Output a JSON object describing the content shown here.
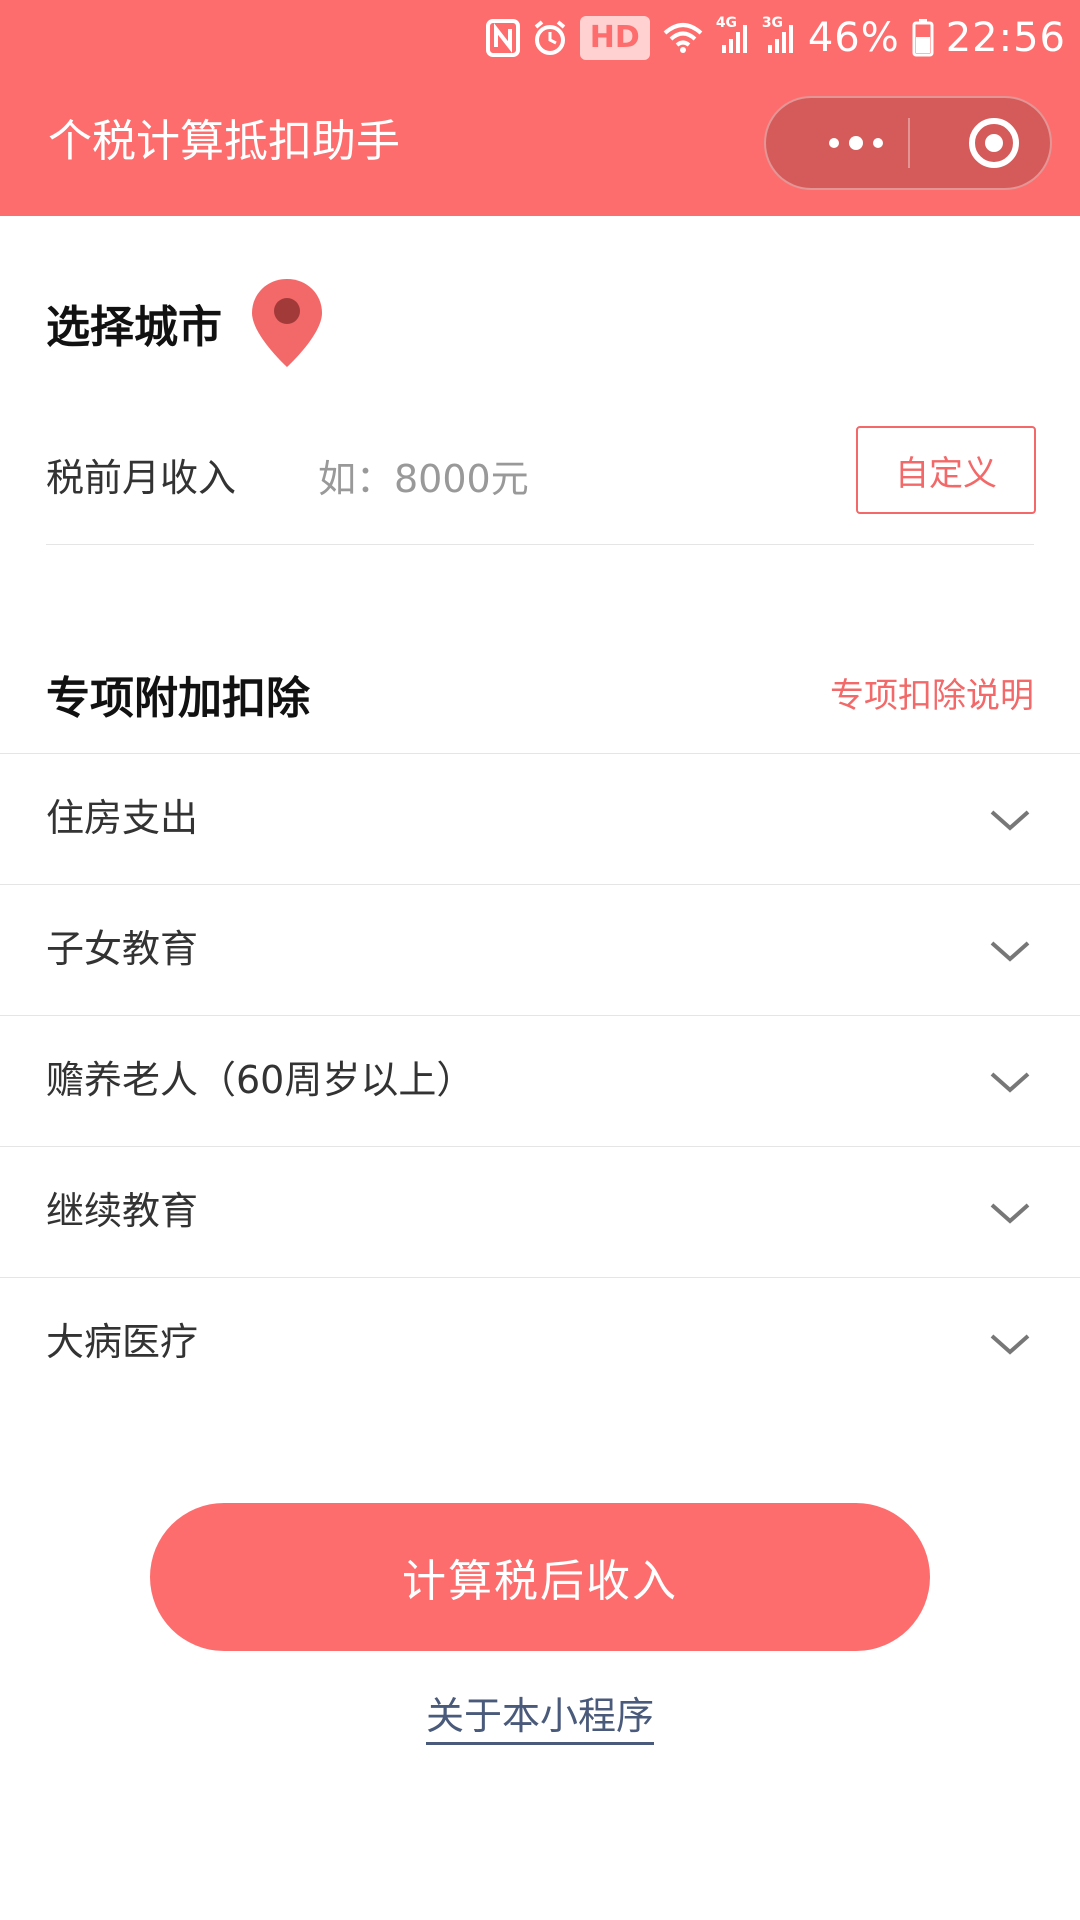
{
  "status_bar": {
    "hd": "HD",
    "net_4g": "4G",
    "net_3g": "3G",
    "battery": "46%",
    "time": "22:56"
  },
  "header": {
    "title": "个税计算抵扣助手"
  },
  "city": {
    "label": "选择城市"
  },
  "income": {
    "label": "税前月收入",
    "placeholder": "如：8000元",
    "value": "",
    "custom_label": "自定义"
  },
  "deductions": {
    "title": "专项附加扣除",
    "help_link": "专项扣除说明",
    "items": [
      {
        "label": "住房支出"
      },
      {
        "label": "子女教育"
      },
      {
        "label": "赡养老人（60周岁以上）"
      },
      {
        "label": "继续教育"
      },
      {
        "label": "大病医疗"
      }
    ]
  },
  "actions": {
    "calculate_label": "计算税后收入",
    "about_label": "关于本小程序"
  },
  "colors": {
    "brand": "#fe6d6d",
    "accent_text": "#f36868",
    "link": "#4a5a7a"
  }
}
